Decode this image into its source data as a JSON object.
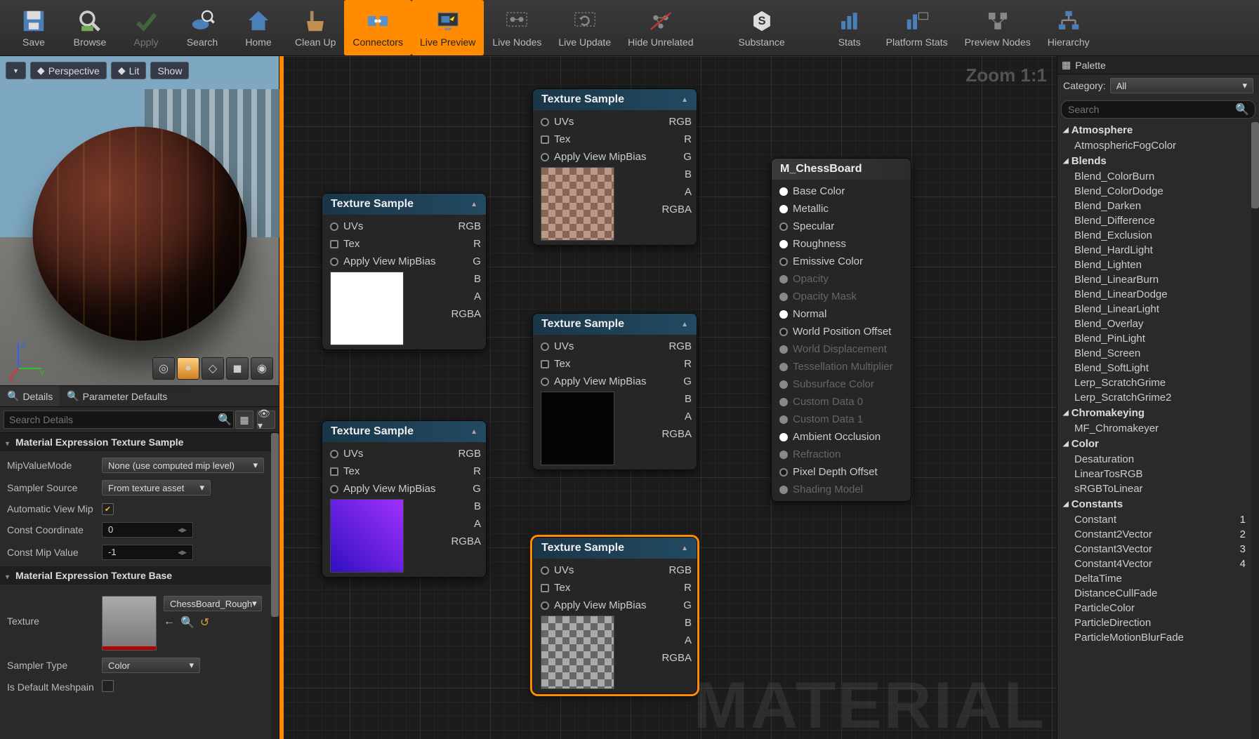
{
  "toolbar": [
    {
      "label": "Save",
      "active": false,
      "disabled": false,
      "icon": "save"
    },
    {
      "label": "Browse",
      "active": false,
      "disabled": false,
      "icon": "browse"
    },
    {
      "label": "Apply",
      "active": false,
      "disabled": true,
      "icon": "apply"
    },
    {
      "label": "Search",
      "active": false,
      "disabled": false,
      "icon": "search"
    },
    {
      "label": "Home",
      "active": false,
      "disabled": false,
      "icon": "home"
    },
    {
      "label": "Clean Up",
      "active": false,
      "disabled": false,
      "icon": "clean"
    },
    {
      "label": "Connectors",
      "active": true,
      "disabled": false,
      "icon": "conn"
    },
    {
      "label": "Live Preview",
      "active": true,
      "disabled": false,
      "icon": "monitor"
    },
    {
      "label": "Live Nodes",
      "active": false,
      "disabled": false,
      "icon": "nodes"
    },
    {
      "label": "Live Update",
      "active": false,
      "disabled": false,
      "icon": "update"
    },
    {
      "label": "Hide Unrelated",
      "active": false,
      "disabled": false,
      "icon": "hide"
    },
    {
      "label": "Substance",
      "active": false,
      "disabled": false,
      "icon": "substance"
    },
    {
      "label": "Stats",
      "active": false,
      "disabled": false,
      "icon": "stats"
    },
    {
      "label": "Platform Stats",
      "active": false,
      "disabled": false,
      "icon": "pstats"
    },
    {
      "label": "Preview Nodes",
      "active": false,
      "disabled": false,
      "icon": "preview"
    },
    {
      "label": "Hierarchy",
      "active": false,
      "disabled": false,
      "icon": "hierarchy"
    }
  ],
  "viewport": {
    "btns": [
      "",
      "Perspective",
      "Lit",
      "Show"
    ],
    "shapes": [
      "cylinder",
      "sphere",
      "plane",
      "cube",
      "teapot"
    ],
    "selected_shape": 1
  },
  "tabs": {
    "details": "Details",
    "params": "Parameter Defaults"
  },
  "search_details_ph": "Search Details",
  "details": {
    "cat1": "Material Expression Texture Sample",
    "mipValueMode": {
      "lbl": "MipValueMode",
      "val": "None (use computed mip level)"
    },
    "samplerSource": {
      "lbl": "Sampler Source",
      "val": "From texture asset"
    },
    "autoViewMip": {
      "lbl": "Automatic View Mip",
      "val": true
    },
    "constCoord": {
      "lbl": "Const Coordinate",
      "val": "0"
    },
    "constMip": {
      "lbl": "Const Mip Value",
      "val": "-1"
    },
    "cat2": "Material Expression Texture Base",
    "texture": {
      "lbl": "Texture",
      "val": "ChessBoard_Rough"
    },
    "samplerType": {
      "lbl": "Sampler Type",
      "val": "Color"
    },
    "isDefault": {
      "lbl": "Is Default Meshpain",
      "val": false
    }
  },
  "graph": {
    "zoom": "Zoom 1:1",
    "watermark": "MATERIAL",
    "tex_title": "Texture Sample",
    "inputs": [
      "UVs",
      "Tex",
      "Apply View MipBias"
    ],
    "outputs": [
      "RGB",
      "R",
      "G",
      "B",
      "A",
      "RGBA"
    ],
    "result": {
      "title": "M_ChessBoard",
      "pins": [
        {
          "name": "Base Color",
          "state": "on"
        },
        {
          "name": "Metallic",
          "state": "on"
        },
        {
          "name": "Specular",
          "state": "open"
        },
        {
          "name": "Roughness",
          "state": "on"
        },
        {
          "name": "Emissive Color",
          "state": "open"
        },
        {
          "name": "Opacity",
          "state": "dim"
        },
        {
          "name": "Opacity Mask",
          "state": "dim"
        },
        {
          "name": "Normal",
          "state": "on"
        },
        {
          "name": "World Position Offset",
          "state": "open"
        },
        {
          "name": "World Displacement",
          "state": "dim"
        },
        {
          "name": "Tessellation Multiplier",
          "state": "dim"
        },
        {
          "name": "Subsurface Color",
          "state": "dim"
        },
        {
          "name": "Custom Data 0",
          "state": "dim"
        },
        {
          "name": "Custom Data 1",
          "state": "dim"
        },
        {
          "name": "Ambient Occlusion",
          "state": "on"
        },
        {
          "name": "Refraction",
          "state": "dim"
        },
        {
          "name": "Pixel Depth Offset",
          "state": "open"
        },
        {
          "name": "Shading Model",
          "state": "dim"
        }
      ]
    }
  },
  "palette": {
    "tab": "Palette",
    "category_lbl": "Category:",
    "category_val": "All",
    "search_ph": "Search",
    "groups": [
      {
        "name": "Atmosphere",
        "items": [
          {
            "n": "AtmosphericFogColor"
          }
        ]
      },
      {
        "name": "Blends",
        "items": [
          {
            "n": "Blend_ColorBurn"
          },
          {
            "n": "Blend_ColorDodge"
          },
          {
            "n": "Blend_Darken"
          },
          {
            "n": "Blend_Difference"
          },
          {
            "n": "Blend_Exclusion"
          },
          {
            "n": "Blend_HardLight"
          },
          {
            "n": "Blend_Lighten"
          },
          {
            "n": "Blend_LinearBurn"
          },
          {
            "n": "Blend_LinearDodge"
          },
          {
            "n": "Blend_LinearLight"
          },
          {
            "n": "Blend_Overlay"
          },
          {
            "n": "Blend_PinLight"
          },
          {
            "n": "Blend_Screen"
          },
          {
            "n": "Blend_SoftLight"
          },
          {
            "n": "Lerp_ScratchGrime"
          },
          {
            "n": "Lerp_ScratchGrime2"
          }
        ]
      },
      {
        "name": "Chromakeying",
        "items": [
          {
            "n": "MF_Chromakeyer"
          }
        ]
      },
      {
        "name": "Color",
        "items": [
          {
            "n": "Desaturation"
          },
          {
            "n": "LinearTosRGB"
          },
          {
            "n": "sRGBToLinear"
          }
        ]
      },
      {
        "name": "Constants",
        "items": [
          {
            "n": "Constant",
            "r": "1"
          },
          {
            "n": "Constant2Vector",
            "r": "2"
          },
          {
            "n": "Constant3Vector",
            "r": "3"
          },
          {
            "n": "Constant4Vector",
            "r": "4"
          },
          {
            "n": "DeltaTime"
          },
          {
            "n": "DistanceCullFade"
          },
          {
            "n": "ParticleColor"
          },
          {
            "n": "ParticleDirection"
          },
          {
            "n": "ParticleMotionBlurFade"
          }
        ]
      }
    ]
  }
}
